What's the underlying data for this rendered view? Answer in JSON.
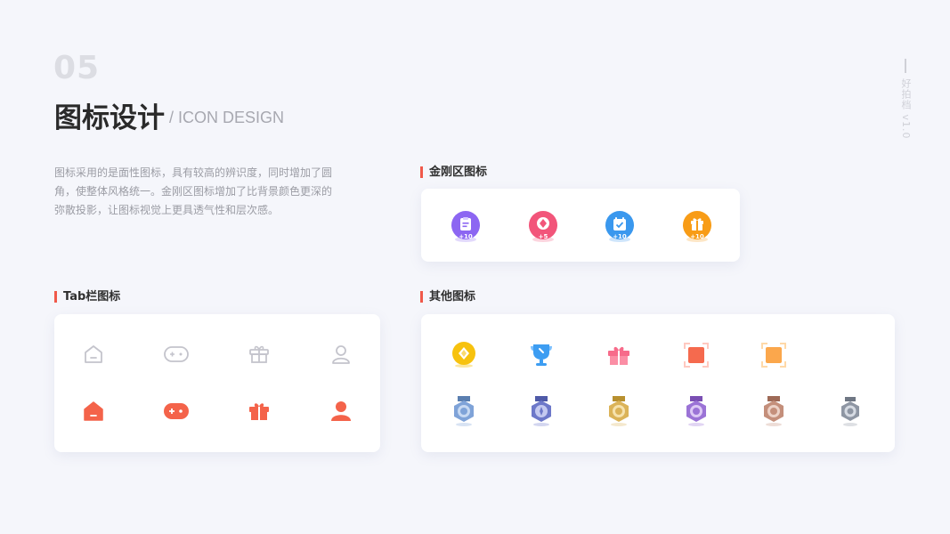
{
  "header": {
    "number": "05",
    "title": "图标设计",
    "subtitle": "/ ICON DESIGN",
    "side_label": "好拍档 v1.0"
  },
  "description": "图标采用的是面性图标，具有较高的辨识度，同时增加了圆角，使整体风格统一。金刚区图标增加了比背景颜色更深的弥散投影，让图标视觉上更具透气性和层次感。",
  "sections": {
    "jingang": {
      "title": "金刚区图标",
      "icons": [
        {
          "name": "clipboard-icon",
          "badge": "+10",
          "color": "#8c66f2"
        },
        {
          "name": "diamond-coin-icon",
          "badge": "+5",
          "color": "#f2557a"
        },
        {
          "name": "calendar-check-icon",
          "badge": "+10",
          "color": "#3a98ee"
        },
        {
          "name": "gift-icon",
          "badge": "+10",
          "color": "#f89c16"
        }
      ]
    },
    "tabbar": {
      "title": "Tab栏图标",
      "outline_color": "#c4c4cc",
      "active_color": "#f4634a",
      "icons": [
        "home-icon",
        "gamepad-icon",
        "gift-icon",
        "user-icon"
      ]
    },
    "others": {
      "title": "其他图标",
      "row1": [
        "gold-coin-icon",
        "trophy-icon",
        "gift-box-icon",
        "scan-frame-red-icon",
        "scan-frame-orange-icon"
      ],
      "row2": [
        "medal-blue-icon",
        "medal-indigo-icon",
        "medal-gold-icon",
        "medal-purple-icon",
        "medal-bronze-icon",
        "medal-gray-icon"
      ]
    }
  }
}
